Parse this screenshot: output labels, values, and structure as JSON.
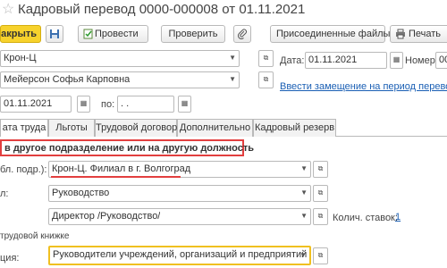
{
  "window": {
    "title": "Кадровый перевод 0000-000008 от 01.11.2021"
  },
  "toolbar": {
    "post_close": "акрыть",
    "conduct": "Провести",
    "check": "Проверить",
    "attached_files": "Присоединенные файлы",
    "print": "Печать"
  },
  "header": {
    "org_value": "Крон-Ц",
    "employee_value": "Мейерсон Софья Карповна",
    "date_from_value": "01.11.2021",
    "to_label": "по:",
    "date_to_value": " .  .",
    "date_label": "Дата:",
    "date_value": "01.11.2021",
    "number_label": "Номер:",
    "number_value": "00",
    "replacement_link": "Ввести замещение на период перевода"
  },
  "tabs": [
    {
      "label": "ата труда"
    },
    {
      "label": "Льготы"
    },
    {
      "label": "Трудовой договор"
    },
    {
      "label": "Дополнительно"
    },
    {
      "label": "Кадровый резерв"
    }
  ],
  "main": {
    "transfer_checkbox_label": "в другое подразделение или на другую должность",
    "subdivision_label": "бл. подр.):",
    "subdivision_value": "Крон-Ц. Филиал в г. Волгоград",
    "group_label": "л:",
    "group_value": "Руководство",
    "position_value": "Директор /Руководство/",
    "rates_label": "Колич. ставок:",
    "rates_value": "1",
    "workbook_label": "трудовой книжке",
    "category_label": "ция:",
    "category_value": "Руководители учреждений, организаций и предприятий"
  },
  "colors": {
    "primary_button": "#f7d22c",
    "highlight_red": "#e23f3f",
    "link": "#1a5fb4"
  }
}
